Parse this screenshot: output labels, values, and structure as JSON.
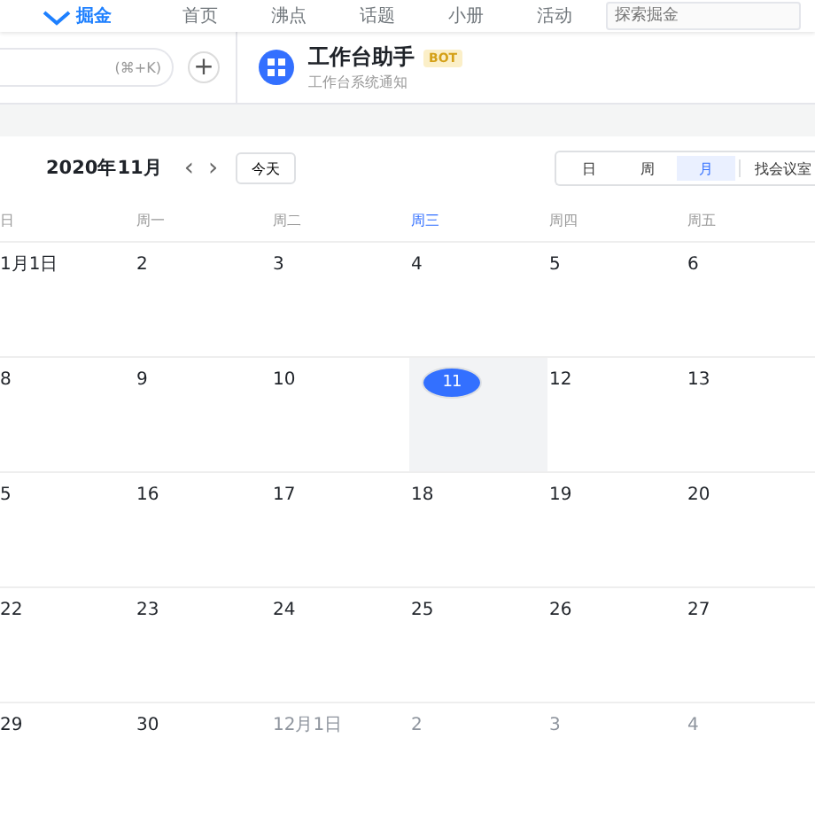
{
  "top_nav": {
    "logo": "掘金",
    "items": [
      "首页",
      "沸点",
      "话题",
      "小册",
      "活动"
    ],
    "search_placeholder": "探索掘金"
  },
  "chat_header": {
    "search_shortcut": "(⌘+K)",
    "add_label": "+",
    "bot_name": "工作台助手",
    "bot_badge": "BOT",
    "bot_subtitle": "工作台系统通知"
  },
  "calendar": {
    "month_title": "2020年11月",
    "prev": "‹",
    "next": "›",
    "today_button": "今天",
    "views": [
      {
        "label": "日",
        "selected": false
      },
      {
        "label": "周",
        "selected": false
      },
      {
        "label": "月",
        "selected": true
      }
    ],
    "room_button": "找会议室",
    "weekdays": [
      {
        "label": "日",
        "current": false
      },
      {
        "label": "周一",
        "current": false
      },
      {
        "label": "周二",
        "current": false
      },
      {
        "label": "周三",
        "current": true
      },
      {
        "label": "周四",
        "current": false
      },
      {
        "label": "周五",
        "current": false
      }
    ],
    "weeks": [
      [
        {
          "label": "1月1日",
          "muted": false,
          "today": false,
          "selected": false
        },
        {
          "label": "2",
          "muted": false,
          "today": false,
          "selected": false
        },
        {
          "label": "3",
          "muted": false,
          "today": false,
          "selected": false
        },
        {
          "label": "4",
          "muted": false,
          "today": false,
          "selected": false
        },
        {
          "label": "5",
          "muted": false,
          "today": false,
          "selected": false
        },
        {
          "label": "6",
          "muted": false,
          "today": false,
          "selected": false
        }
      ],
      [
        {
          "label": "8",
          "muted": false,
          "today": false,
          "selected": false
        },
        {
          "label": "9",
          "muted": false,
          "today": false,
          "selected": false
        },
        {
          "label": "10",
          "muted": false,
          "today": false,
          "selected": false
        },
        {
          "label": "11",
          "muted": false,
          "today": true,
          "selected": true
        },
        {
          "label": "12",
          "muted": false,
          "today": false,
          "selected": false
        },
        {
          "label": "13",
          "muted": false,
          "today": false,
          "selected": false
        }
      ],
      [
        {
          "label": "5",
          "muted": false,
          "today": false,
          "selected": false
        },
        {
          "label": "16",
          "muted": false,
          "today": false,
          "selected": false
        },
        {
          "label": "17",
          "muted": false,
          "today": false,
          "selected": false
        },
        {
          "label": "18",
          "muted": false,
          "today": false,
          "selected": false
        },
        {
          "label": "19",
          "muted": false,
          "today": false,
          "selected": false
        },
        {
          "label": "20",
          "muted": false,
          "today": false,
          "selected": false
        }
      ],
      [
        {
          "label": "22",
          "muted": false,
          "today": false,
          "selected": false
        },
        {
          "label": "23",
          "muted": false,
          "today": false,
          "selected": false
        },
        {
          "label": "24",
          "muted": false,
          "today": false,
          "selected": false
        },
        {
          "label": "25",
          "muted": false,
          "today": false,
          "selected": false
        },
        {
          "label": "26",
          "muted": false,
          "today": false,
          "selected": false
        },
        {
          "label": "27",
          "muted": false,
          "today": false,
          "selected": false
        }
      ],
      [
        {
          "label": "29",
          "muted": false,
          "today": false,
          "selected": false
        },
        {
          "label": "30",
          "muted": false,
          "today": false,
          "selected": false
        },
        {
          "label": "12月1日",
          "muted": true,
          "today": false,
          "selected": false
        },
        {
          "label": "2",
          "muted": true,
          "today": false,
          "selected": false
        },
        {
          "label": "3",
          "muted": true,
          "today": false,
          "selected": false
        },
        {
          "label": "4",
          "muted": true,
          "today": false,
          "selected": false
        }
      ]
    ]
  }
}
